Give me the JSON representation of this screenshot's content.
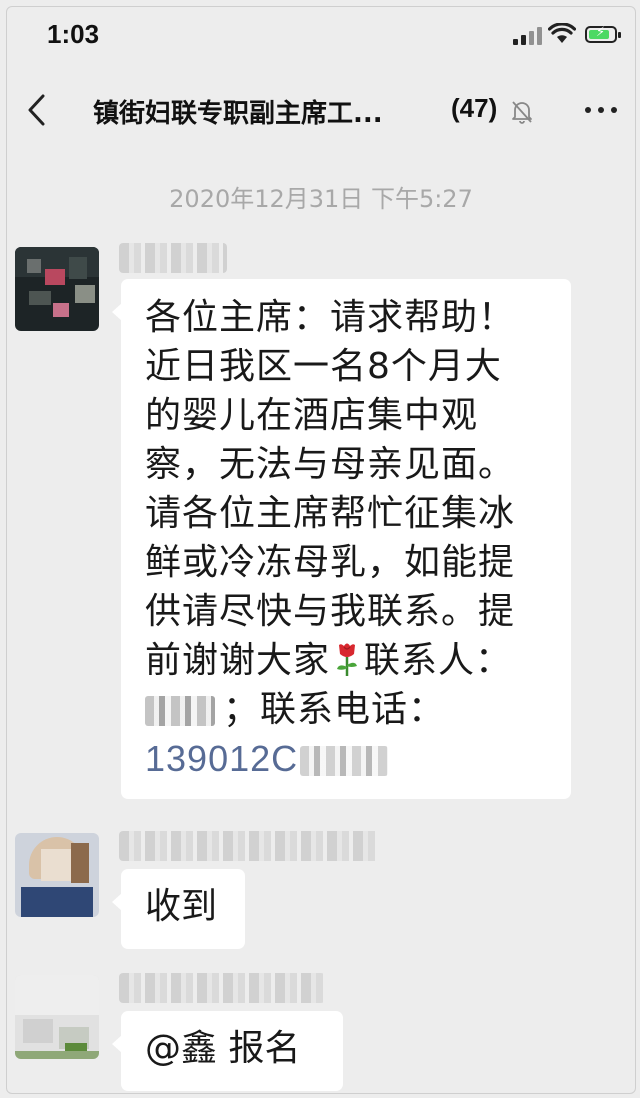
{
  "status_bar": {
    "time": "1:03",
    "icons": [
      "signal-icon",
      "wifi-icon",
      "battery-charging-icon"
    ]
  },
  "nav": {
    "back_icon": "chevron-left-icon",
    "title": "镇街妇联专职副主席工...",
    "member_count": "(47)",
    "mute_icon": "bell-muted-icon",
    "more_icon": "more-dots-icon"
  },
  "chat": {
    "timestamp": "2020年12月31日 下午5:27",
    "messages": [
      {
        "lines": [
          "各位主席：请求帮助！",
          "近日我区一名8个月大",
          "的婴儿在酒店集中观",
          "察，无法与母亲见面。",
          "请各位主席帮忙征集冰",
          "鲜或冷冻母乳，如能提",
          "供请尽快与我联系。提"
        ],
        "line_8_before": "前谢谢大家",
        "emoji": "rose-icon",
        "line_8_after": "联系人：",
        "line_9_text": "；联系电话：",
        "phone_partial": "139012C"
      },
      {
        "text": "收到"
      },
      {
        "text": "@鑫 报名"
      }
    ]
  },
  "colors": {
    "background": "#ededed",
    "bubble": "#ffffff",
    "link": "#576b95",
    "timestamp": "#a8a8a8",
    "battery": "#4cd964"
  }
}
